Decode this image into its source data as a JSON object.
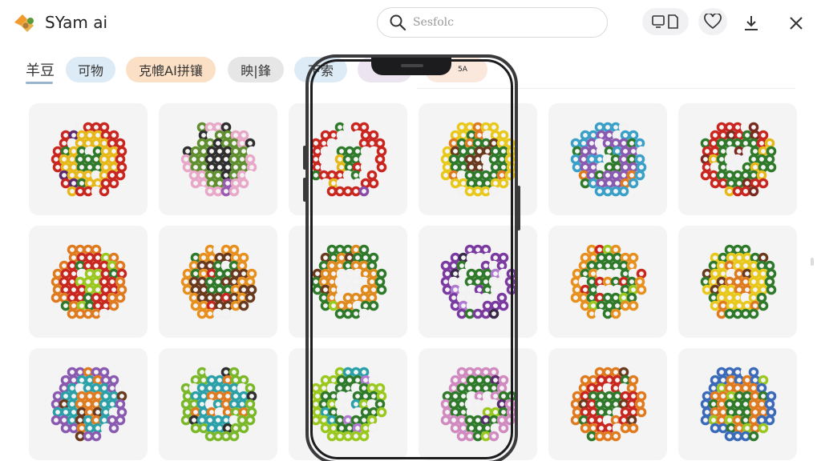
{
  "header": {
    "app_name": "SYam ai",
    "search_placeholder": "Sesfolc",
    "icons": [
      "logo-icon",
      "search-icon",
      "device-toggle-icon",
      "heart-icon",
      "download-icon",
      "close-icon"
    ]
  },
  "tabs": [
    {
      "label": "羊豆",
      "active": true
    },
    {
      "label": "可物",
      "color": "#dcebf5"
    },
    {
      "label": "克㡙AI拼镶",
      "color": "#fbe0c6"
    },
    {
      "label": "眏|鋒",
      "color": "#e6e6e6"
    },
    {
      "label": "下索",
      "color": "#dcebf5"
    },
    {
      "label": "",
      "color": "#ece4f0"
    },
    {
      "label": "",
      "color": "#fbe8dc"
    }
  ],
  "phone_status": "5A",
  "gallery": [
    {
      "name": "red-flower-pattern",
      "palette": [
        "#c8261e",
        "#e6b81a",
        "#2f7a2a",
        "#f2f2f2",
        "#5e2a6e"
      ]
    },
    {
      "name": "pink-green-pattern",
      "palette": [
        "#e8a8c8",
        "#5f8f2f",
        "#2f2f2f",
        "#f5f5f5",
        "#9a5ab0"
      ]
    },
    {
      "name": "red-white-pattern",
      "palette": [
        "#c8261e",
        "#f2f2f2",
        "#2f7a2a",
        "#8a4aa8",
        "#e6b81a"
      ]
    },
    {
      "name": "yellow-green-pattern",
      "palette": [
        "#e8c81a",
        "#2f7a2a",
        "#6a3a1e",
        "#f2f2f2",
        "#e07a1e"
      ]
    },
    {
      "name": "blue-purple-pattern",
      "palette": [
        "#3aa0c8",
        "#8a5ab0",
        "#2f7a2a",
        "#e07a1e",
        "#f2f2f2"
      ]
    },
    {
      "name": "red-green-ring-pattern",
      "palette": [
        "#c8261e",
        "#2f7a2a",
        "#f2f2f2",
        "#e6b81a",
        "#7a2a1e"
      ]
    },
    {
      "name": "multicolor-orange-pattern",
      "palette": [
        "#e07a1e",
        "#c8261e",
        "#9ac81e",
        "#2f7a2a",
        "#f2f2f2"
      ]
    },
    {
      "name": "orange-brown-pattern",
      "palette": [
        "#e8901e",
        "#6a3a1e",
        "#2f7a2a",
        "#f2f2f2",
        "#c8261e"
      ]
    },
    {
      "name": "green-orange-pattern",
      "palette": [
        "#2f7a2a",
        "#e08a1e",
        "#f2f2f2",
        "#6a3a1e",
        "#9ac81e"
      ]
    },
    {
      "name": "purple-white-pattern",
      "palette": [
        "#7a3aa0",
        "#f2f2f2",
        "#2f7a2a",
        "#3a2a4a",
        "#b07ad0"
      ]
    },
    {
      "name": "orange-green-dots-pattern",
      "palette": [
        "#e8901e",
        "#2f7a2a",
        "#f2f2f2",
        "#9ac81e",
        "#c8261e"
      ]
    },
    {
      "name": "green-yellow-orange-pattern",
      "palette": [
        "#2f7a2a",
        "#e8c81a",
        "#e07a1e",
        "#f2f2f2",
        "#6a3a1e"
      ]
    },
    {
      "name": "purple-teal-pattern",
      "palette": [
        "#8a5ab0",
        "#2aa0a8",
        "#e07a1e",
        "#f2f2f2",
        "#6a3a1e"
      ]
    },
    {
      "name": "lime-teal-pattern",
      "palette": [
        "#7ab82a",
        "#2aa0a8",
        "#e07a1e",
        "#f2f2f2",
        "#2f2f2f"
      ]
    },
    {
      "name": "lime-white-pattern",
      "palette": [
        "#9ac81e",
        "#2f7a2a",
        "#f2f2f2",
        "#b07ad0",
        "#2aa0a8"
      ]
    },
    {
      "name": "pink-green-swirl-pattern",
      "palette": [
        "#d08ac0",
        "#2f7a2a",
        "#f2f2f2",
        "#5a2a6e",
        "#9ac81e"
      ]
    },
    {
      "name": "orange-red-scatter-pattern",
      "palette": [
        "#e07a1e",
        "#c8261e",
        "#2f7a2a",
        "#f2f2f2",
        "#6a3a1e"
      ]
    },
    {
      "name": "blue-green-patchwork-pattern",
      "palette": [
        "#3a6ab8",
        "#e07a1e",
        "#2f7a2a",
        "#f2f2f2",
        "#9ac81e"
      ]
    }
  ]
}
